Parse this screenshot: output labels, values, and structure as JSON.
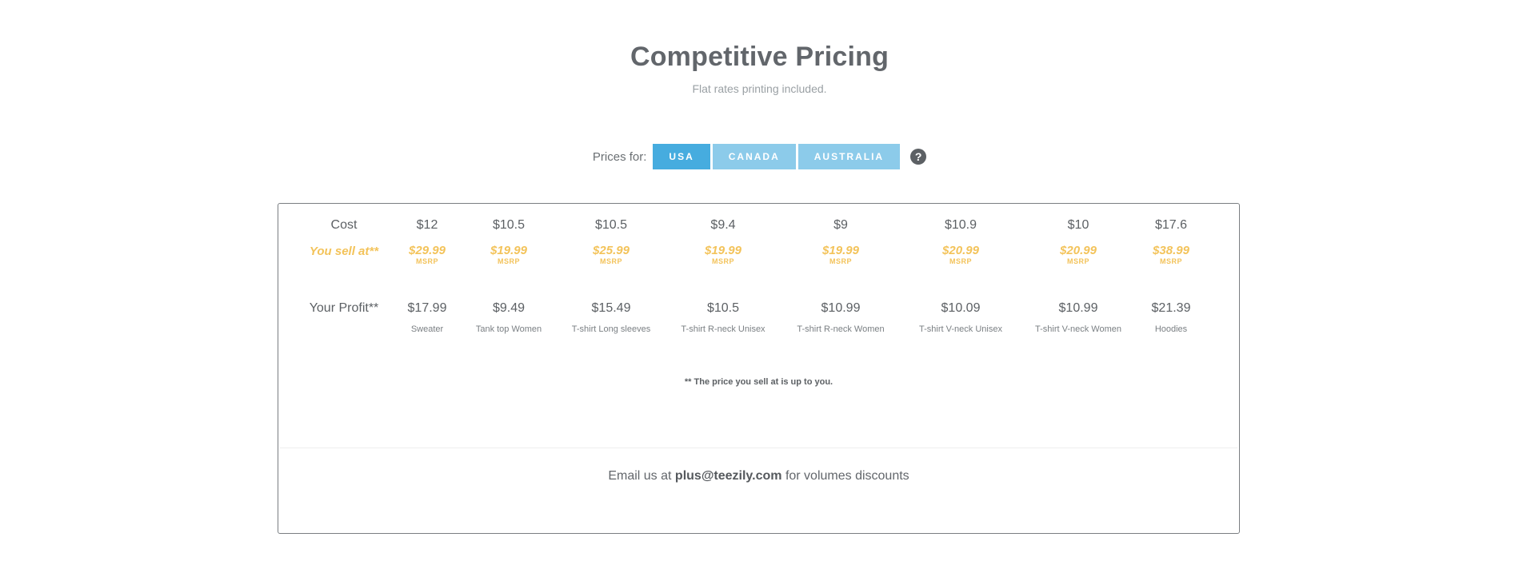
{
  "header": {
    "title": "Competitive Pricing",
    "subtitle": "Flat rates printing included."
  },
  "prices_for": {
    "label": "Prices for:",
    "countries": [
      "USA",
      "CANADA",
      "AUSTRALIA"
    ],
    "selected": "USA",
    "help_icon": "question-circle-icon"
  },
  "table": {
    "row_labels": {
      "cost": "Cost",
      "sell": "You sell at**",
      "profit": "Your Profit**"
    },
    "msrp_label": "MSRP",
    "products": [
      {
        "name": "Sweater",
        "cost": "$12",
        "sell": "$29.99",
        "profit": "$17.99"
      },
      {
        "name": "Tank top Women",
        "cost": "$10.5",
        "sell": "$19.99",
        "profit": "$9.49"
      },
      {
        "name": "T-shirt Long sleeves",
        "cost": "$10.5",
        "sell": "$25.99",
        "profit": "$15.49"
      },
      {
        "name": "T-shirt R-neck Unisex",
        "cost": "$9.4",
        "sell": "$19.99",
        "profit": "$10.5"
      },
      {
        "name": "T-shirt R-neck Women",
        "cost": "$9",
        "sell": "$19.99",
        "profit": "$10.99"
      },
      {
        "name": "T-shirt V-neck Unisex",
        "cost": "$10.9",
        "sell": "$20.99",
        "profit": "$10.09"
      },
      {
        "name": "T-shirt V-neck Women",
        "cost": "$10",
        "sell": "$20.99",
        "profit": "$10.99"
      },
      {
        "name": "Hoodies",
        "cost": "$17.6",
        "sell": "$38.99",
        "profit": "$21.39"
      }
    ],
    "footnote": "** The price you sell at is up to you."
  },
  "footer": {
    "prefix": "Email us at",
    "email": "plus@teezily.com",
    "suffix": "for volumes discounts"
  },
  "colors": {
    "accent_active": "#46acdf",
    "accent_inactive": "#8ccbea",
    "sell_highlight": "#f3c35a"
  }
}
